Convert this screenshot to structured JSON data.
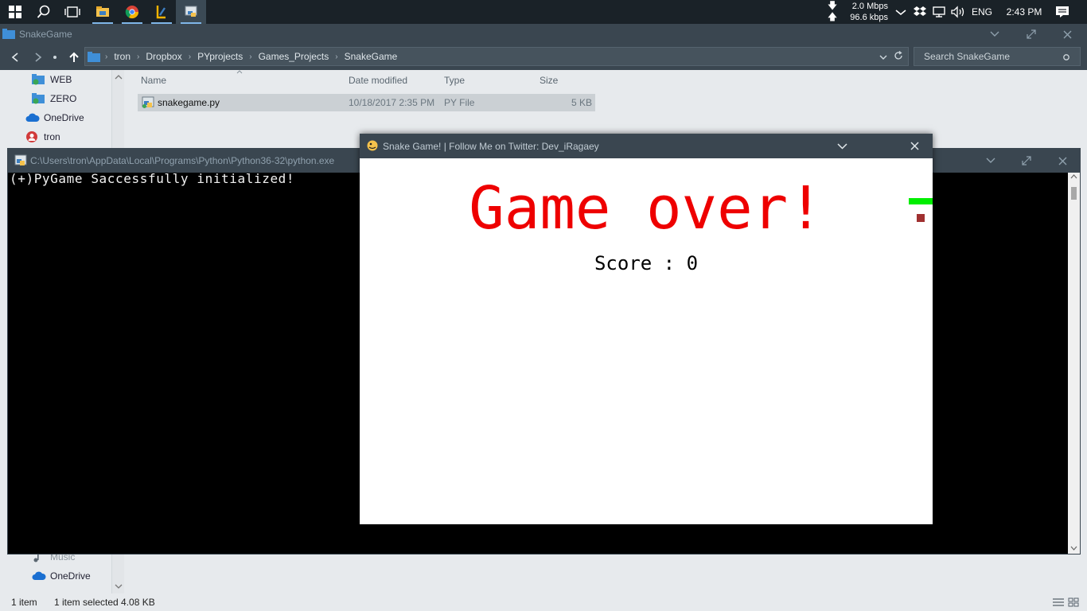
{
  "taskbar": {
    "netspeed": {
      "down": "2.0 Mbps",
      "up": "96.6 kbps"
    },
    "language": "ENG",
    "time": "2:43 PM"
  },
  "explorer": {
    "title": "SnakeGame",
    "path": [
      "tron",
      "Dropbox",
      "PYprojects",
      "Games_Projects",
      "SnakeGame"
    ],
    "search_placeholder": "Search SnakeGame",
    "nav_items": [
      "WEB",
      "ZERO",
      "OneDrive",
      "tron",
      "Music",
      "OneDrive"
    ],
    "columns": {
      "name": "Name",
      "date": "Date modified",
      "type": "Type",
      "size": "Size"
    },
    "files": [
      {
        "name": "snakegame.py",
        "date": "10/18/2017 2:35 PM",
        "type": "PY File",
        "size": "5 KB"
      }
    ],
    "status": {
      "count": "1 item",
      "selected": "1 item selected  4.08 KB"
    }
  },
  "console": {
    "title": "C:\\Users\\tron\\AppData\\Local\\Programs\\Python\\Python36-32\\python.exe",
    "output": "(+)PyGame Saccessfully initialized!"
  },
  "game": {
    "title": "Snake Game! | Follow Me on Twitter: Dev_iRagaey",
    "message": "Game over!",
    "score_text": "Score : 0",
    "colors": {
      "message": "#ee0000",
      "snake": "#00ee00",
      "food": "#a03030"
    }
  }
}
